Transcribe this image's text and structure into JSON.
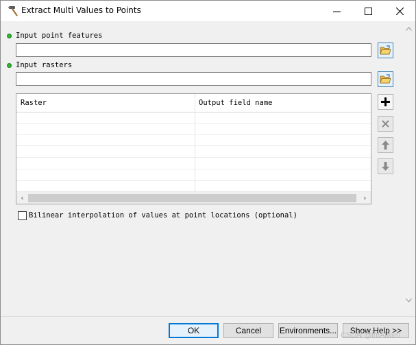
{
  "window": {
    "title": "Extract Multi Values to Points",
    "minimize_icon": "minimize-icon",
    "maximize_icon": "maximize-icon",
    "close_icon": "close-icon"
  },
  "params": {
    "input_point_features": {
      "label": "Input point features",
      "value": ""
    },
    "input_rasters": {
      "label": "Input rasters",
      "value": ""
    }
  },
  "raster_table": {
    "columns": [
      "Raster",
      "Output field name"
    ],
    "rows": []
  },
  "table_tools": {
    "add_icon": "plus-icon",
    "remove_icon": "x-icon",
    "up_icon": "arrow-up-icon",
    "down_icon": "arrow-down-icon"
  },
  "bilinear": {
    "label": "Bilinear interpolation of values at point locations (optional)",
    "checked": false
  },
  "footer": {
    "ok": "OK",
    "cancel": "Cancel",
    "environments": "Environments...",
    "show_help": "Show Help >>"
  },
  "watermark": "CSDN @lmAlwen",
  "colors": {
    "required_dot": "#2fb82f",
    "accent": "#0078d7"
  }
}
